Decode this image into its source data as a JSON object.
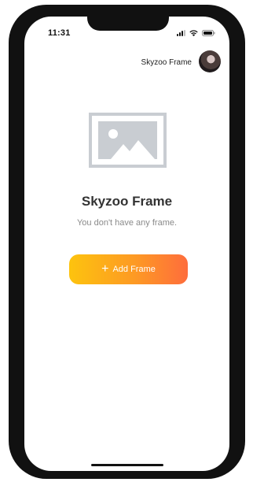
{
  "status_bar": {
    "time": "11:31",
    "icons": [
      "signal-icon",
      "wifi-icon",
      "battery-icon"
    ]
  },
  "header": {
    "name": "Skyzoo Frame",
    "avatar": "avatar"
  },
  "empty_state": {
    "icon": "image-placeholder-icon",
    "title": "Skyzoo Frame",
    "subtitle": "You don't have any frame."
  },
  "add_button": {
    "icon": "plus-icon",
    "label": "Add Frame"
  },
  "colors": {
    "gradient_start": "#fdc30e",
    "gradient_end": "#fe6d3c",
    "title": "#333333",
    "subtitle": "#8a8a8a",
    "placeholder": "#c9cdd2"
  }
}
